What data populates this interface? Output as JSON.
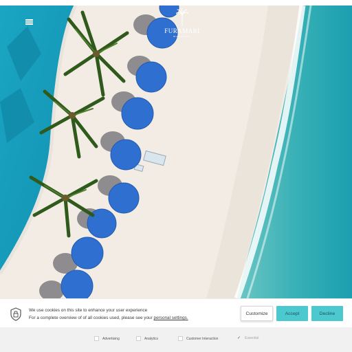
{
  "header": {
    "menu_icon": "hamburger-menu-icon",
    "logo_icon": "palm-tree-logo-icon",
    "logo_text": "FURAMARI",
    "logo_subtext": "MALDIVES"
  },
  "cookie_banner": {
    "icon": "cookie-shield-icon",
    "line1": "We use cookies on this site to enhance your user experience",
    "line2_prefix": "For a complete overview of of all cookies used, please see your ",
    "line2_link": "personal settings.",
    "buttons": {
      "customize": "Customize",
      "accept": "Accept",
      "decline": "Decline"
    },
    "accent_color": "#4cc9cf"
  },
  "preferences": [
    {
      "label": "Advertising",
      "checked": false,
      "disabled": false
    },
    {
      "label": "Analytics",
      "checked": false,
      "disabled": false
    },
    {
      "label": "Customer Interaction",
      "checked": false,
      "disabled": false
    },
    {
      "label": "Essential",
      "checked": true,
      "disabled": true
    }
  ]
}
